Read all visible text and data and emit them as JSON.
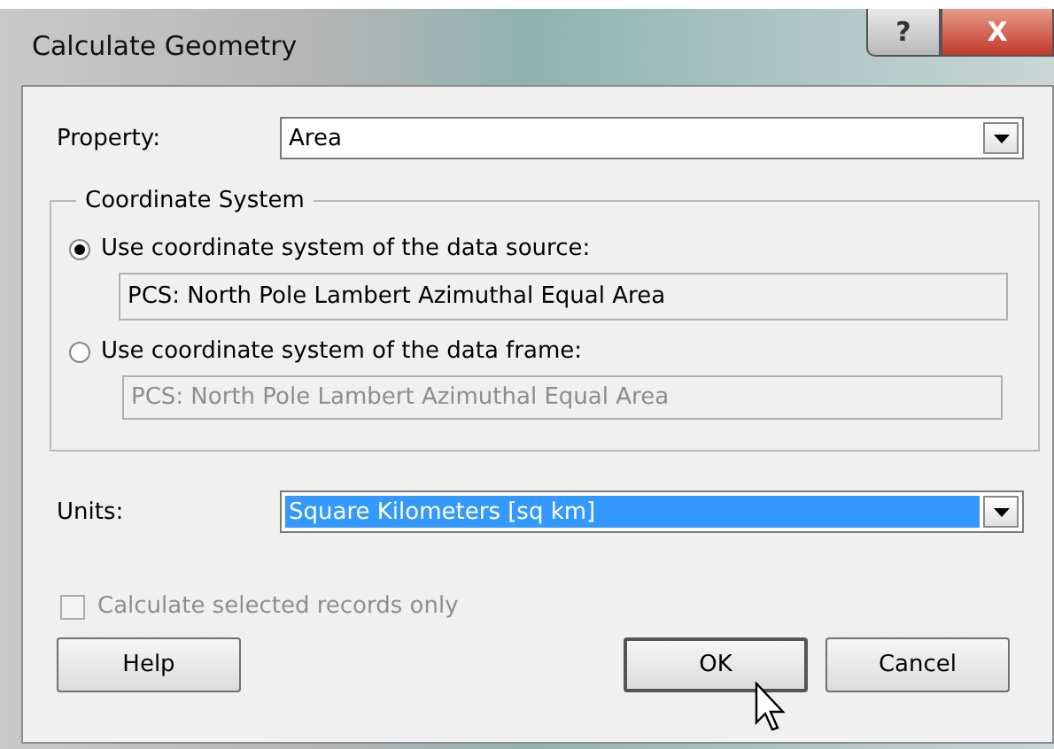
{
  "window": {
    "title": "Calculate Geometry",
    "help_button": "?",
    "close_button": "X"
  },
  "property": {
    "label": "Property:",
    "value": "Area",
    "selected": false
  },
  "coordinate_system": {
    "title": "Coordinate System",
    "options": [
      {
        "label": "Use coordinate system of the data source:",
        "value": "PCS: North Pole Lambert Azimuthal Equal Area",
        "selected": true
      },
      {
        "label": "Use coordinate system of the data frame:",
        "value": "PCS: North Pole Lambert Azimuthal Equal Area",
        "selected": false
      }
    ]
  },
  "units": {
    "label": "Units:",
    "value": "Square Kilometers [sq km]",
    "selected": true
  },
  "selected_only": {
    "label": "Calculate selected records only",
    "checked": false,
    "disabled": true
  },
  "buttons": [
    {
      "label": "Help",
      "default": false
    },
    {
      "label": "OK",
      "default": true
    },
    {
      "label": "Cancel",
      "default": false
    }
  ]
}
